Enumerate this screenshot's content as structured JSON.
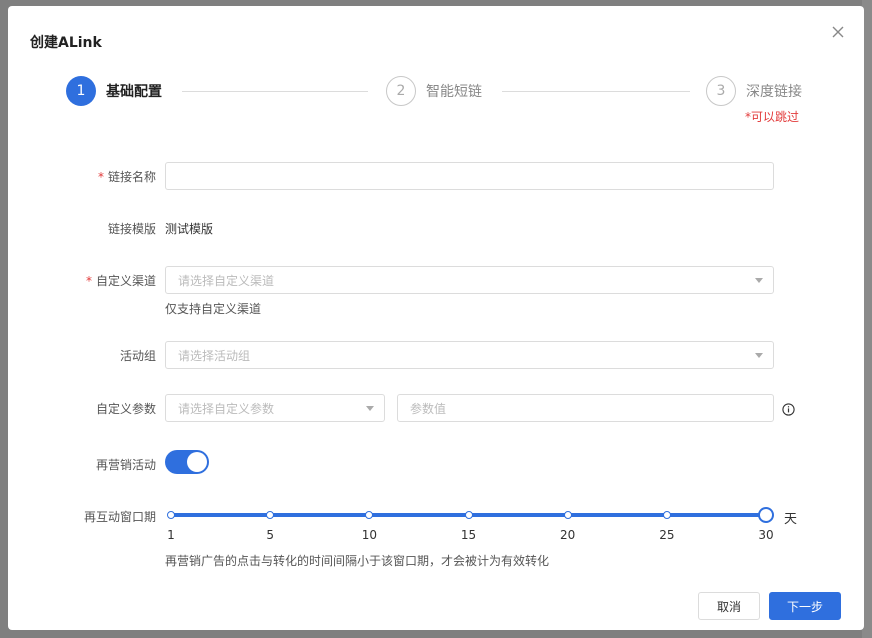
{
  "modal": {
    "title": "创建ALink"
  },
  "steps": [
    {
      "number": "1",
      "label": "基础配置",
      "state": "active"
    },
    {
      "number": "2",
      "label": "智能短链",
      "state": "idle"
    },
    {
      "number": "3",
      "label": "深度链接",
      "state": "idle",
      "note": "*可以跳过"
    }
  ],
  "form": {
    "link_name": {
      "label": "链接名称",
      "required": "*",
      "value": ""
    },
    "link_template": {
      "label": "链接模版",
      "value": "测试模版"
    },
    "custom_channel": {
      "label": "自定义渠道",
      "required": "*",
      "placeholder": "请选择自定义渠道",
      "hint": "仅支持自定义渠道"
    },
    "activity_group": {
      "label": "活动组",
      "placeholder": "请选择活动组"
    },
    "custom_params": {
      "label": "自定义参数",
      "select_placeholder": "请选择自定义参数",
      "value_placeholder": "参数值"
    },
    "remarketing": {
      "label": "再营销活动",
      "enabled": true
    },
    "window_period": {
      "label": "再互动窗口期",
      "ticks": [
        "1",
        "5",
        "10",
        "15",
        "20",
        "25",
        "30"
      ],
      "value": 30,
      "unit": "天",
      "hint": "再营销广告的点击与转化的时间间隔小于该窗口期，才会被计为有效转化"
    }
  },
  "footer": {
    "cancel_label": "取消",
    "next_label": "下一步"
  },
  "colors": {
    "primary": "#2f6fde",
    "required": "#e23a3a"
  },
  "icons": {
    "close": "close-icon",
    "info": "info-icon",
    "dropdown": "chevron-down-icon"
  }
}
